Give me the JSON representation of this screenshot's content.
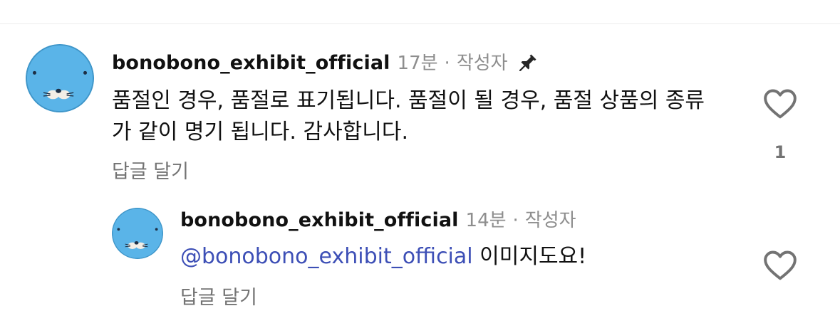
{
  "comment": {
    "username": "bonobono_exhibit_official",
    "time": "17분",
    "separator": "·",
    "author_tag": "작성자",
    "pin_icon": "pin-icon",
    "text": "품절인 경우, 품절로 표기됩니다. 품절이 될 경우, 품절 상품의 종류가 같이 명기 됩니다. 감사합니다.",
    "reply_label": "답글 달기",
    "like_icon": "heart-outline-icon",
    "like_count": "1"
  },
  "reply": {
    "username": "bonobono_exhibit_official",
    "time": "14분",
    "separator": "·",
    "author_tag": "작성자",
    "mention": "@bonobono_exhibit_official",
    "text": " 이미지도요!",
    "reply_label": "답글 달기",
    "like_icon": "heart-outline-icon"
  },
  "colors": {
    "mention": "#3d4fb6",
    "avatar_blue": "#5ab4e8",
    "muted_text": "#8e8e8e"
  }
}
